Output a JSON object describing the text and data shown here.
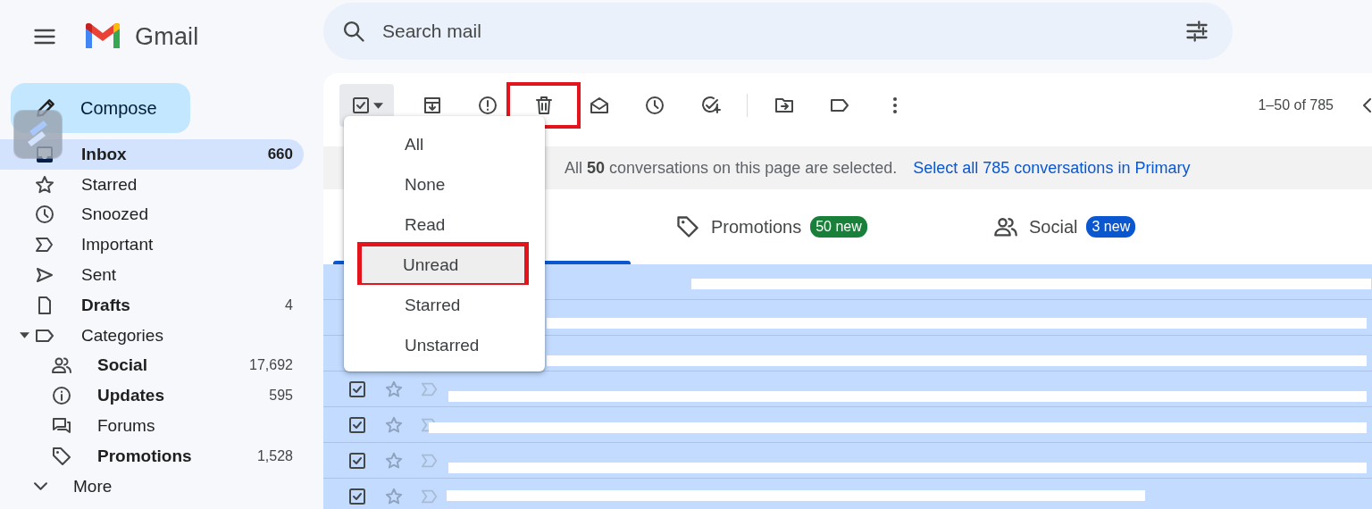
{
  "app": {
    "name": "Gmail"
  },
  "search": {
    "placeholder": "Search mail"
  },
  "compose": {
    "label": "Compose"
  },
  "sidebar": {
    "items": [
      {
        "label": "Inbox",
        "count": "660",
        "unread": true,
        "selected": true
      },
      {
        "label": "Starred",
        "unread": false,
        "selected": false
      },
      {
        "label": "Snoozed",
        "unread": false,
        "selected": false
      },
      {
        "label": "Important",
        "unread": false,
        "selected": false
      },
      {
        "label": "Sent",
        "unread": false,
        "selected": false
      },
      {
        "label": "Drafts",
        "count": "4",
        "unread": true,
        "selected": false
      },
      {
        "label": "Categories",
        "unread": false,
        "selected": false,
        "expanded": true,
        "children": [
          {
            "label": "Social",
            "count": "17,692",
            "unread": true,
            "selected": false
          },
          {
            "label": "Updates",
            "count": "595",
            "unread": true,
            "selected": false
          },
          {
            "label": "Forums",
            "unread": false,
            "selected": false
          },
          {
            "label": "Promotions",
            "count": "1,528",
            "unread": true,
            "selected": false
          }
        ]
      },
      {
        "label": "More",
        "unread": false,
        "selected": false
      }
    ]
  },
  "toolbar": {
    "select_checked": true,
    "menu_open": true,
    "actions": [
      {
        "highlighted": false
      },
      {
        "highlighted": false
      },
      {
        "highlighted": true
      },
      {
        "highlighted": false
      },
      {
        "highlighted": false
      },
      {
        "highlighted": false
      },
      {
        "highlighted": false
      },
      {
        "highlighted": false
      },
      {
        "highlighted": false
      }
    ],
    "pagination": "1–50 of 785"
  },
  "select_menu": {
    "items": [
      {
        "label": "All",
        "hovered": false,
        "highlighted": false
      },
      {
        "label": "None",
        "hovered": false,
        "highlighted": false
      },
      {
        "label": "Read",
        "hovered": false,
        "highlighted": false
      },
      {
        "label": "Unread",
        "hovered": true,
        "highlighted": true
      },
      {
        "label": "Starred",
        "hovered": false,
        "highlighted": false
      },
      {
        "label": "Unstarred",
        "hovered": false,
        "highlighted": false
      }
    ]
  },
  "banner": {
    "text": "All **50** conversations on this page are selected.",
    "link": "Select all 785 conversations in Primary"
  },
  "tabs": [
    {
      "selected": true
    },
    {
      "label": "Promotions",
      "badge": "50 new",
      "color": "#188038",
      "selected": false
    },
    {
      "label": "Social",
      "badge": "3 new",
      "color": "#0b57d0",
      "selected": false
    }
  ],
  "rows": [
    {
      "checked": true,
      "covered": true
    },
    {
      "checked": true,
      "covered": true
    },
    {
      "checked": true,
      "covered": true
    },
    {
      "checked": true,
      "covered": false
    },
    {
      "checked": true,
      "covered": false
    },
    {
      "checked": true,
      "covered": false
    },
    {
      "checked": true,
      "covered": false
    }
  ]
}
